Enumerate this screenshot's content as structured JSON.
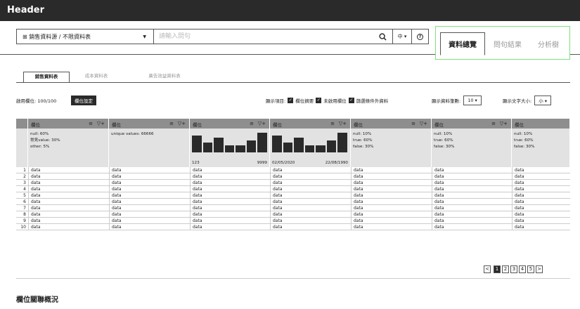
{
  "header": {
    "title": "Header"
  },
  "search": {
    "source_label": "⊞ 銷售資料源 / 不限資料表",
    "placeholder": "請輸入問句",
    "lang": "中 ▾",
    "help": "?"
  },
  "main_tabs": [
    {
      "label": "資料總覽",
      "active": true
    },
    {
      "label": "問句結果",
      "active": false
    },
    {
      "label": "分析樹",
      "active": false
    }
  ],
  "sub_tabs": [
    {
      "label": "銷售資料表",
      "active": true
    },
    {
      "label": "成本資料表",
      "active": false
    },
    {
      "label": "廣告效益資料表",
      "active": false
    }
  ],
  "toolbar": {
    "enabled_columns": "啟用欄位: 100/100",
    "column_settings": "欄位設定",
    "display_items_label": "顯示項目:",
    "opt_summary": "欄位摘要",
    "opt_disabled": "未啟用欄位",
    "opt_filtered": "篩選條件外資料",
    "rows_label": "顯示資料筆數:",
    "rows_value": "10 ▾",
    "font_label": "顯示文字大小:",
    "font_value": "小 ▾"
  },
  "table": {
    "column_label": "欄位",
    "columns": [
      {
        "summary": [
          "null: 60%",
          "常見value: 30%",
          "other: 5%"
        ]
      },
      {
        "summary": [
          "unique values: 66666"
        ]
      },
      {
        "hist": [
          70,
          40,
          60,
          30,
          30,
          50,
          80
        ],
        "min": "123",
        "max": "9999"
      },
      {
        "hist": [
          70,
          40,
          60,
          30,
          30,
          50,
          80
        ],
        "min": "02/05/2020",
        "max": "22/08/1990"
      },
      {
        "summary": [
          "null: 10%",
          "true: 60%",
          "false: 30%"
        ]
      },
      {
        "summary": [
          "null: 10%",
          "true: 60%",
          "false: 30%"
        ]
      },
      {
        "summary": [
          "null: 10%",
          "true: 60%",
          "false: 30%"
        ]
      }
    ],
    "rows": [
      "1",
      "2",
      "3",
      "4",
      "5",
      "6",
      "7",
      "8",
      "9",
      "10"
    ],
    "cell_value": "data"
  },
  "pager": {
    "prev": "<",
    "pages": [
      "1",
      "2",
      "3",
      "4",
      "5"
    ],
    "current": "1",
    "next": ">"
  },
  "section": {
    "title": "欄位關聯概況"
  }
}
